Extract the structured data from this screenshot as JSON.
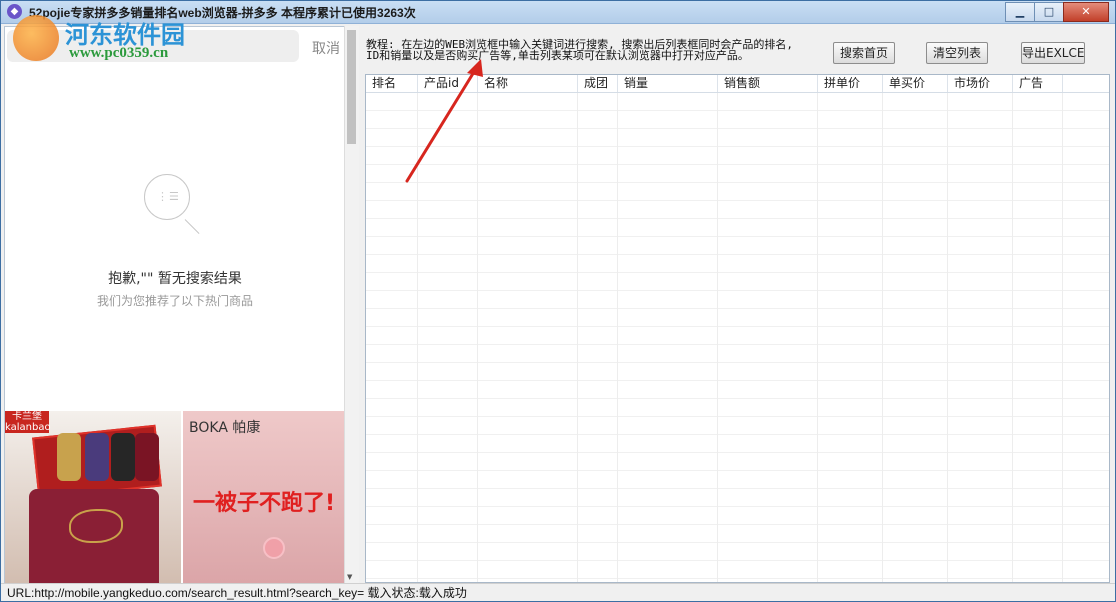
{
  "window": {
    "title": "52pojie专家拼多多销量排名web浏览器-拼多多    本程序累计已使用3263次",
    "min_glyph": "▁",
    "max_glyph": "□",
    "close_glyph": "✕"
  },
  "watermark": {
    "name": "河东软件园",
    "url": "www.pc0359.cn"
  },
  "browser": {
    "cancel_label": "取消",
    "empty_title": "抱歉,\"\" 暂无搜索结果",
    "empty_subtitle": "我们为您推荐了以下热门商品",
    "product1_brand": "卡兰堡 kalanbao",
    "product2_brand": "BOKA 帕康",
    "product2_banner": "一被子不跑了!"
  },
  "tutorial": {
    "line1": "教程: 在左边的WEB浏览框中输入关键词进行搜索, 搜索出后列表框同时会产品的排名,",
    "line2": "ID和销量以及是否购买广告等,单击列表某项可在默认浏览器中打开对应产品。"
  },
  "toolbar": {
    "search_home": "搜索首页",
    "clear_list": "清空列表",
    "export": "导出EXLCE"
  },
  "table": {
    "columns": [
      "排名",
      "产品id",
      "名称",
      "成团",
      "销量",
      "销售额",
      "拼单价",
      "单买价",
      "市场价",
      "广告"
    ]
  },
  "status": {
    "text": "URL:http://mobile.yangkeduo.com/search_result.html?search_key= 载入状态:载入成功"
  },
  "colors": {
    "titlebar": "#c9def4",
    "arrow": "#d7261e",
    "close": "#c2402a"
  }
}
